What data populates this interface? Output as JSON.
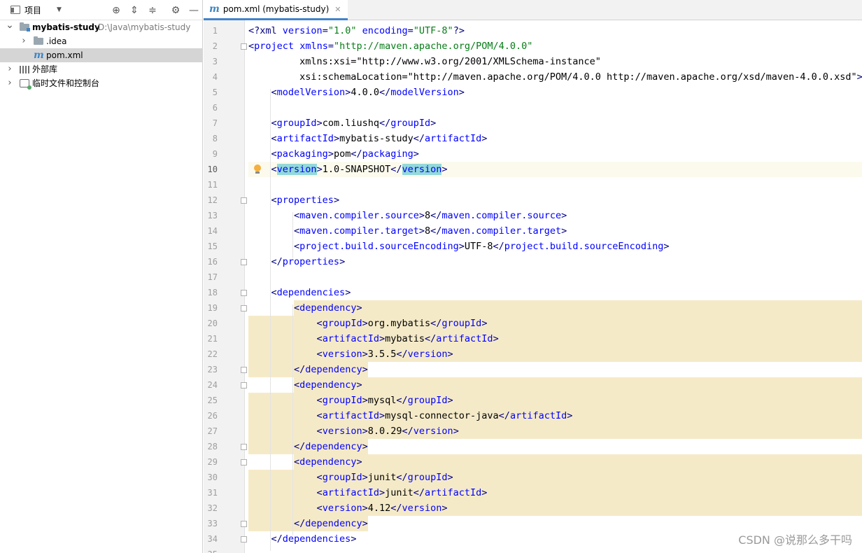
{
  "project_panel": {
    "title": "项目",
    "tree": [
      {
        "label": "mybatis-study",
        "path": "D:\\Java\\mybatis-study",
        "icon": "project-folder-icon",
        "expanded": true,
        "depth": 0
      },
      {
        "label": ".idea",
        "icon": "folder-icon",
        "expanded": false,
        "depth": 1
      },
      {
        "label": "pom.xml",
        "icon": "maven-file-icon",
        "selected": true,
        "depth": 1
      },
      {
        "label": "外部库",
        "icon": "library-icon",
        "expanded": false,
        "depth": 0
      },
      {
        "label": "临时文件和控制台",
        "icon": "scratches-icon",
        "expanded": false,
        "depth": 0
      }
    ]
  },
  "editor": {
    "tab_label": "pom.xml (mybatis-study)",
    "current_line": 10,
    "lines": [
      "<?xml version=\"1.0\" encoding=\"UTF-8\"?>",
      "<project xmlns=\"http://maven.apache.org/POM/4.0.0\"",
      "         xmlns:xsi=\"http://www.w3.org/2001/XMLSchema-instance\"",
      "         xsi:schemaLocation=\"http://maven.apache.org/POM/4.0.0 http://maven.apache.org/xsd/maven-4.0.0.xsd\">",
      "    <modelVersion>4.0.0</modelVersion>",
      "",
      "    <groupId>com.liushq</groupId>",
      "    <artifactId>mybatis-study</artifactId>",
      "    <packaging>pom</packaging>",
      "    <version>1.0-SNAPSHOT</version>",
      "",
      "    <properties>",
      "        <maven.compiler.source>8</maven.compiler.source>",
      "        <maven.compiler.target>8</maven.compiler.target>",
      "        <project.build.sourceEncoding>UTF-8</project.build.sourceEncoding>",
      "    </properties>",
      "",
      "    <dependencies>",
      "        <dependency>",
      "            <groupId>org.mybatis</groupId>",
      "            <artifactId>mybatis</artifactId>",
      "            <version>3.5.5</version>",
      "        </dependency>",
      "        <dependency>",
      "            <groupId>mysql</groupId>",
      "            <artifactId>mysql-connector-java</artifactId>",
      "            <version>8.0.29</version>",
      "        </dependency>",
      "        <dependency>",
      "            <groupId>junit</groupId>",
      "            <artifactId>junit</artifactId>",
      "            <version>4.12</version>",
      "        </dependency>",
      "    </dependencies>",
      ""
    ]
  },
  "watermark": "CSDN @说那么多干吗",
  "colors": {
    "tag": "#000080",
    "attr_name": "#0000ff",
    "namespace": "#660e7a",
    "attr_value": "#067d17",
    "dependency_highlight": "#f5eac8",
    "current_line": "#fcfaed",
    "tab_underline": "#4083c9"
  }
}
